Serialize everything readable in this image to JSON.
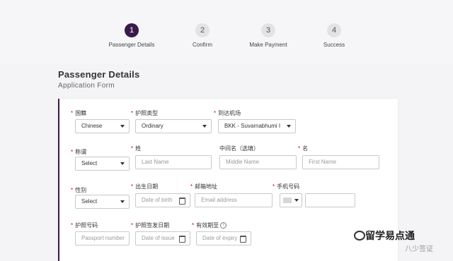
{
  "steps": [
    {
      "number": "1",
      "label": "Passenger Details"
    },
    {
      "number": "2",
      "label": "Confirm"
    },
    {
      "number": "3",
      "label": "Make Payment"
    },
    {
      "number": "4",
      "label": "Success"
    }
  ],
  "heading": {
    "title": "Passenger Details",
    "subtitle": "Application Form"
  },
  "form": {
    "nationality": {
      "label": "国籍",
      "value": "Chinese"
    },
    "passport_type": {
      "label": "护照类型",
      "value": "Ordinary"
    },
    "arrival_airport": {
      "label": "到达机场",
      "value": "BKK - Suvarnabhumi I"
    },
    "title_field": {
      "label": "称谓",
      "value": "Select"
    },
    "last_name": {
      "label": "姓",
      "placeholder": "Last Name"
    },
    "middle_name": {
      "label": "中间名（选填）",
      "placeholder": "Middle Name"
    },
    "first_name": {
      "label": "名",
      "placeholder": "First Name"
    },
    "gender": {
      "label": "性别",
      "value": "Select"
    },
    "dob": {
      "label": "出生日期",
      "placeholder": "Date of birth"
    },
    "email": {
      "label": "邮箱地址",
      "placeholder": "Email address"
    },
    "phone": {
      "label": "手机号码"
    },
    "passport_no": {
      "label": "护照号码",
      "placeholder": "Passport number"
    },
    "issue_date": {
      "label": "护照签发日期",
      "placeholder": "Date of issue"
    },
    "expiry_date": {
      "label": "有效期至",
      "placeholder": "Date of expiry"
    }
  },
  "watermark": {
    "main": "留学易点通",
    "sub": "八少签证"
  },
  "colors": {
    "accent": "#3a1a4a",
    "required": "#d0021b"
  }
}
